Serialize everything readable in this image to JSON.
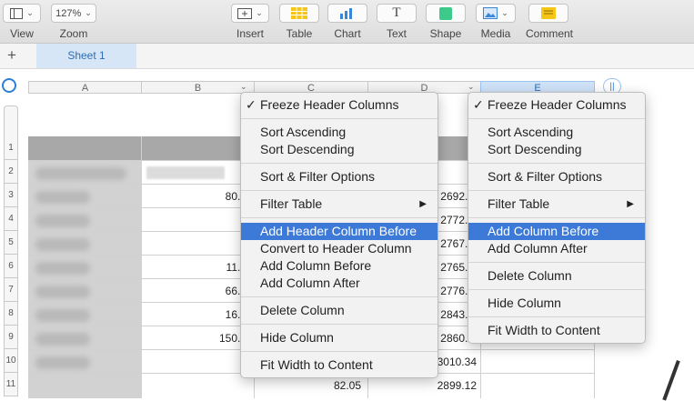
{
  "toolbar": {
    "view_label": "View",
    "zoom_label": "Zoom",
    "zoom_value": "127%",
    "insert_label": "Insert",
    "table_label": "Table",
    "chart_label": "Chart",
    "text_label": "Text",
    "shape_label": "Shape",
    "media_label": "Media",
    "comment_label": "Comment",
    "accent_colors": {
      "table": "#f5c518",
      "chart": "#3a86d6",
      "shape": "#3cc98a",
      "comment": "#f5c518"
    }
  },
  "tabs": {
    "add_sheet_icon": "plus-icon",
    "sheet_label": "Sheet 1"
  },
  "columns": [
    "A",
    "B",
    "C",
    "D",
    "E"
  ],
  "rows": [
    "1",
    "2",
    "3",
    "4",
    "5",
    "6",
    "7",
    "8",
    "9",
    "10",
    "11"
  ],
  "table": {
    "col_b": [
      "80.0",
      "",
      "",
      "11.1",
      "66.8",
      "16.6",
      "150.0",
      "",
      "",
      "82.05"
    ],
    "col_d": [
      "2692.9",
      "2772.9",
      "2767.4",
      "2765.7",
      "2776.8",
      "2843.6",
      "2860.3",
      "3010.34",
      "2899.12"
    ]
  },
  "menu_left": {
    "freeze": "Freeze Header Columns",
    "sort_asc": "Sort Ascending",
    "sort_desc": "Sort Descending",
    "sort_filter": "Sort & Filter Options",
    "filter_table": "Filter Table",
    "add_header_before": "Add Header Column Before",
    "convert_header": "Convert to Header Column",
    "add_before": "Add Column Before",
    "add_after": "Add Column After",
    "delete": "Delete Column",
    "hide": "Hide Column",
    "fit": "Fit Width to Content"
  },
  "menu_right": {
    "freeze": "Freeze Header Columns",
    "sort_asc": "Sort Ascending",
    "sort_desc": "Sort Descending",
    "sort_filter": "Sort & Filter Options",
    "filter_table": "Filter Table",
    "add_before": "Add Column Before",
    "add_after": "Add Column After",
    "delete": "Delete Column",
    "hide": "Hide Column",
    "fit": "Fit Width to Content"
  },
  "highlight_color": "#3d7ad8"
}
